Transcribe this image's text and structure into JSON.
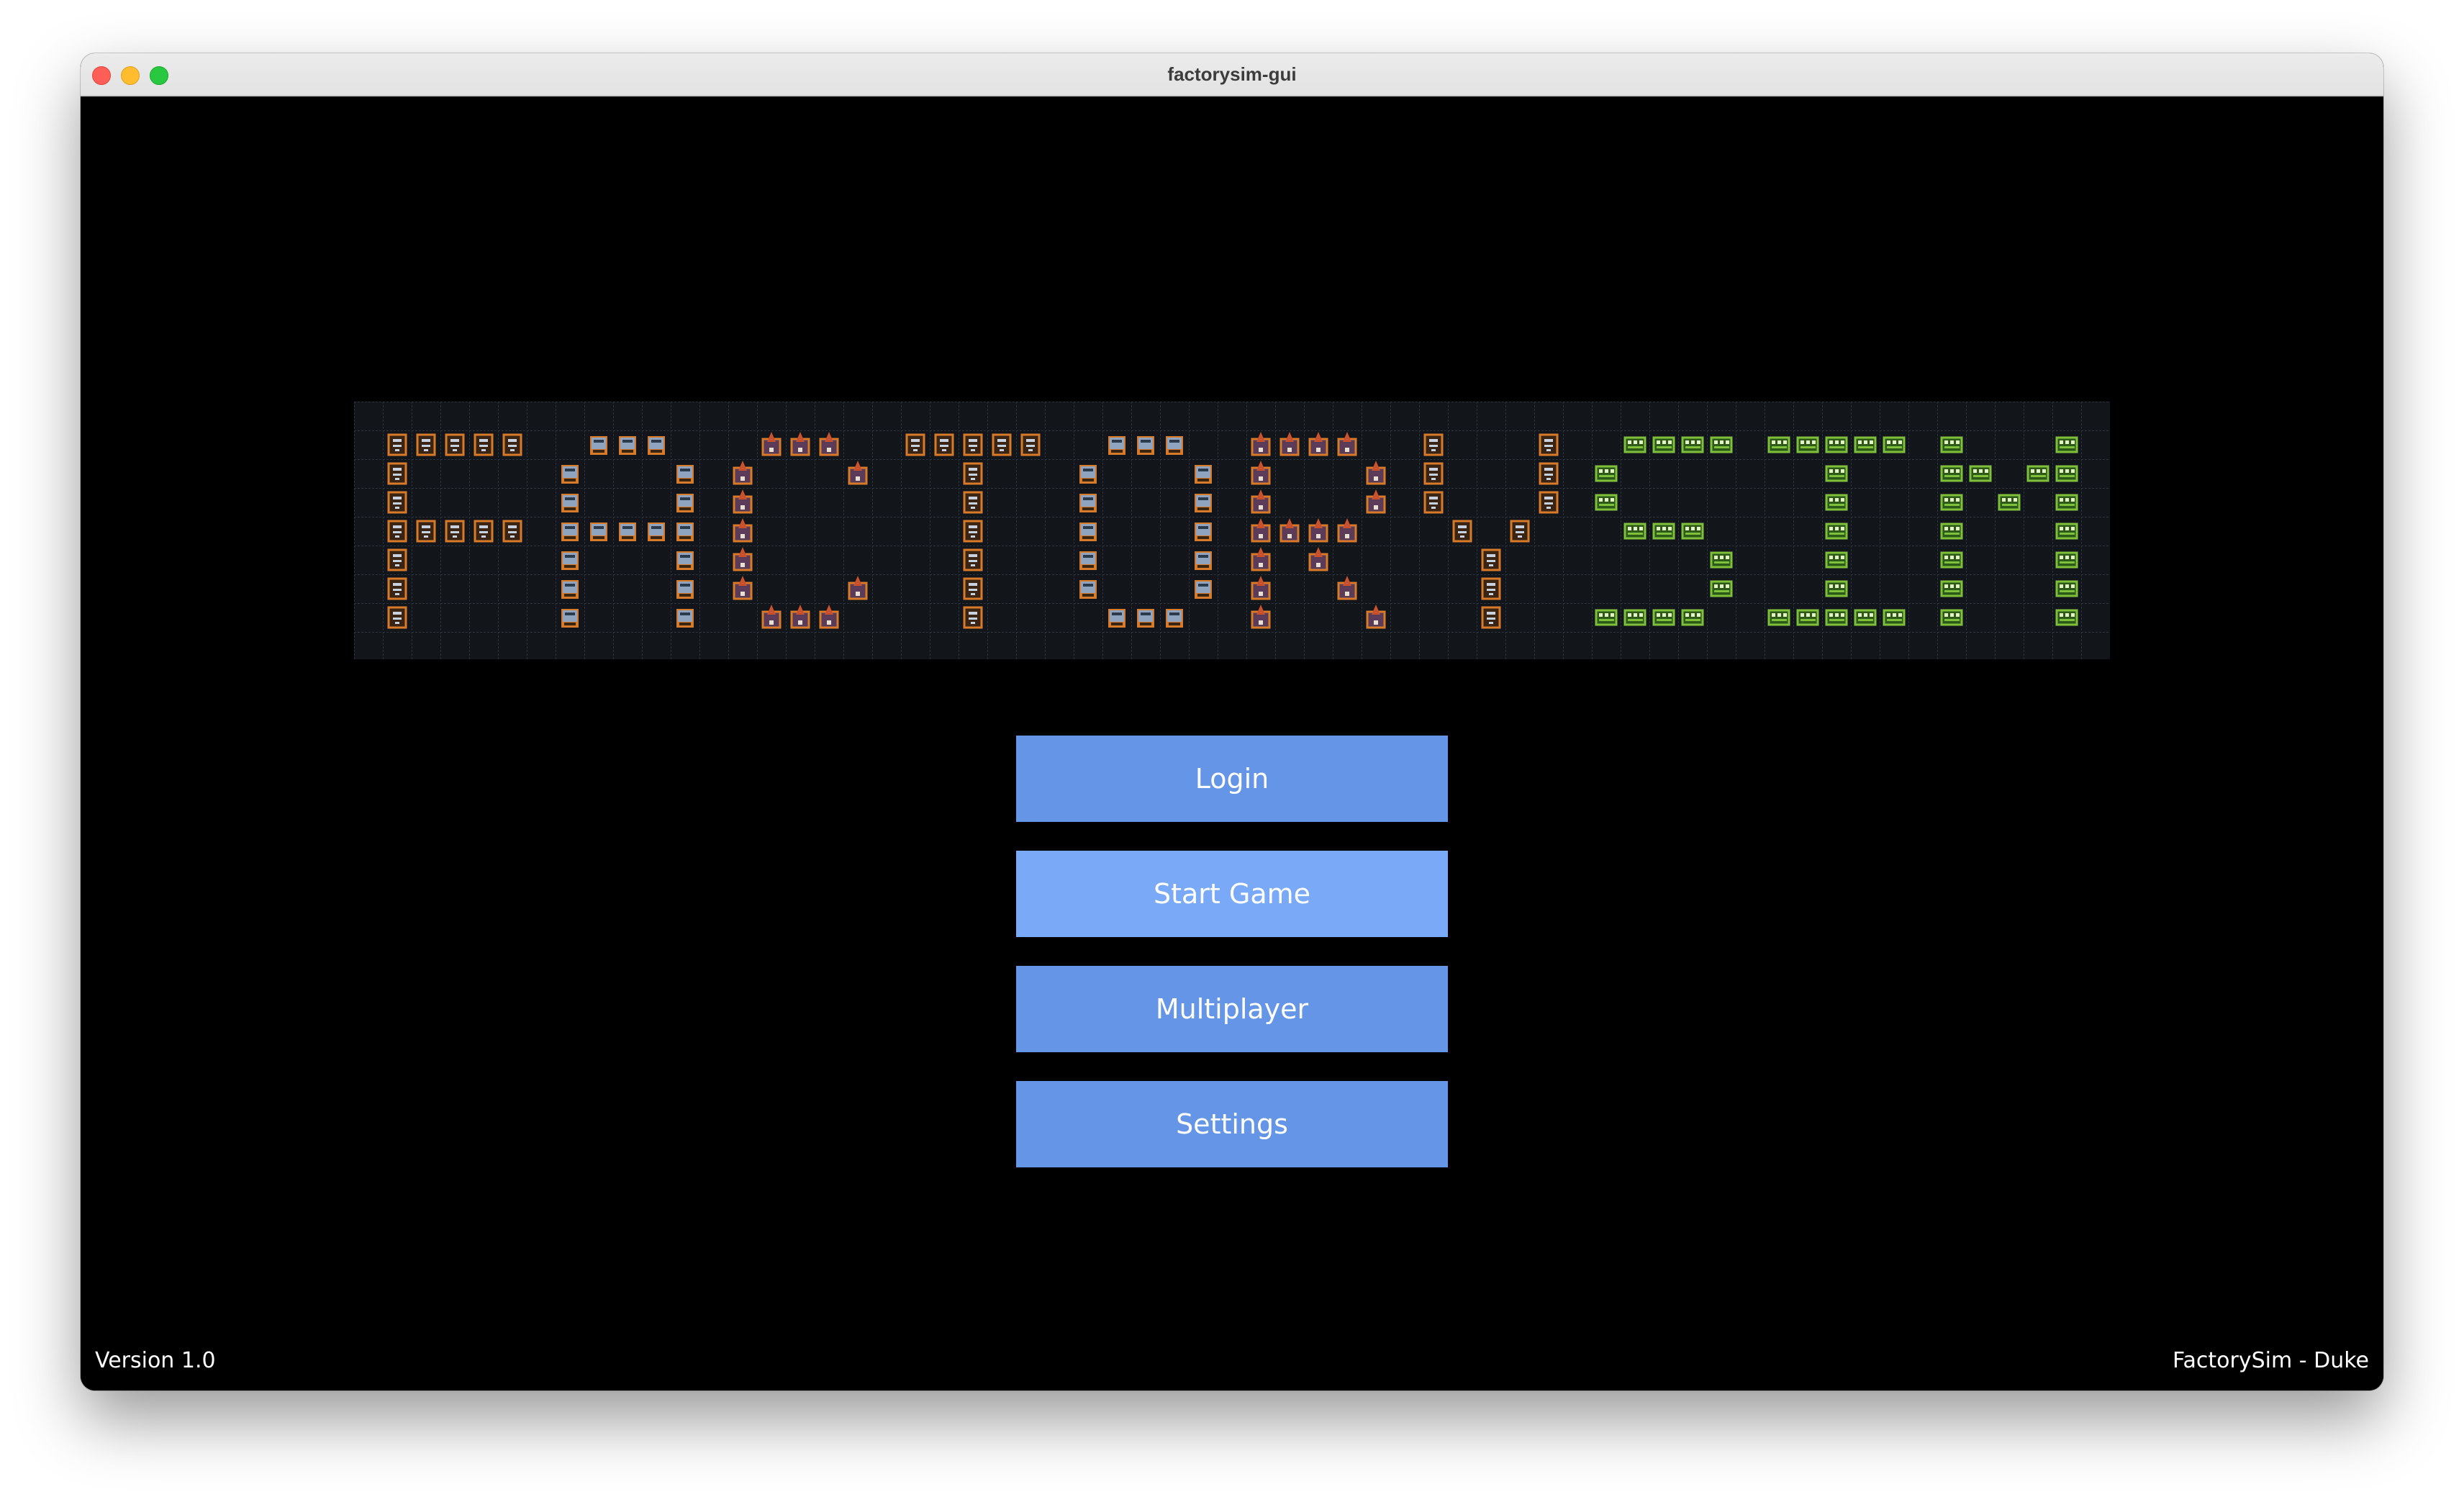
{
  "window": {
    "title": "factorysim-gui"
  },
  "logo": {
    "letters": [
      {
        "ch": "F",
        "tile": "conveyor"
      },
      {
        "ch": "A",
        "tile": "machine"
      },
      {
        "ch": "C",
        "tile": "drill"
      },
      {
        "ch": "T",
        "tile": "conveyor"
      },
      {
        "ch": "O",
        "tile": "machine"
      },
      {
        "ch": "R",
        "tile": "drill"
      },
      {
        "ch": "Y",
        "tile": "conveyor"
      },
      {
        "ch": "S",
        "tile": "circuit"
      },
      {
        "ch": "I",
        "tile": "circuit"
      },
      {
        "ch": "M",
        "tile": "circuit"
      }
    ],
    "colors": {
      "board": "#12161b",
      "grid": "#2b3440",
      "conveyor": "#d77a2a",
      "machine": "#8fa4bf",
      "drill": "#c8502d",
      "circuit": "#7fbf3c"
    }
  },
  "menu": {
    "items": [
      {
        "id": "login",
        "label": "Login"
      },
      {
        "id": "start-game",
        "label": "Start Game"
      },
      {
        "id": "multiplayer",
        "label": "Multiplayer"
      },
      {
        "id": "settings",
        "label": "Settings"
      }
    ],
    "colors": {
      "button": "#6495e6",
      "button_hover": "#7aaaf7",
      "text": "#ffffff"
    }
  },
  "footer": {
    "version": "Version 1.0",
    "credit": "FactorySim - Duke"
  }
}
